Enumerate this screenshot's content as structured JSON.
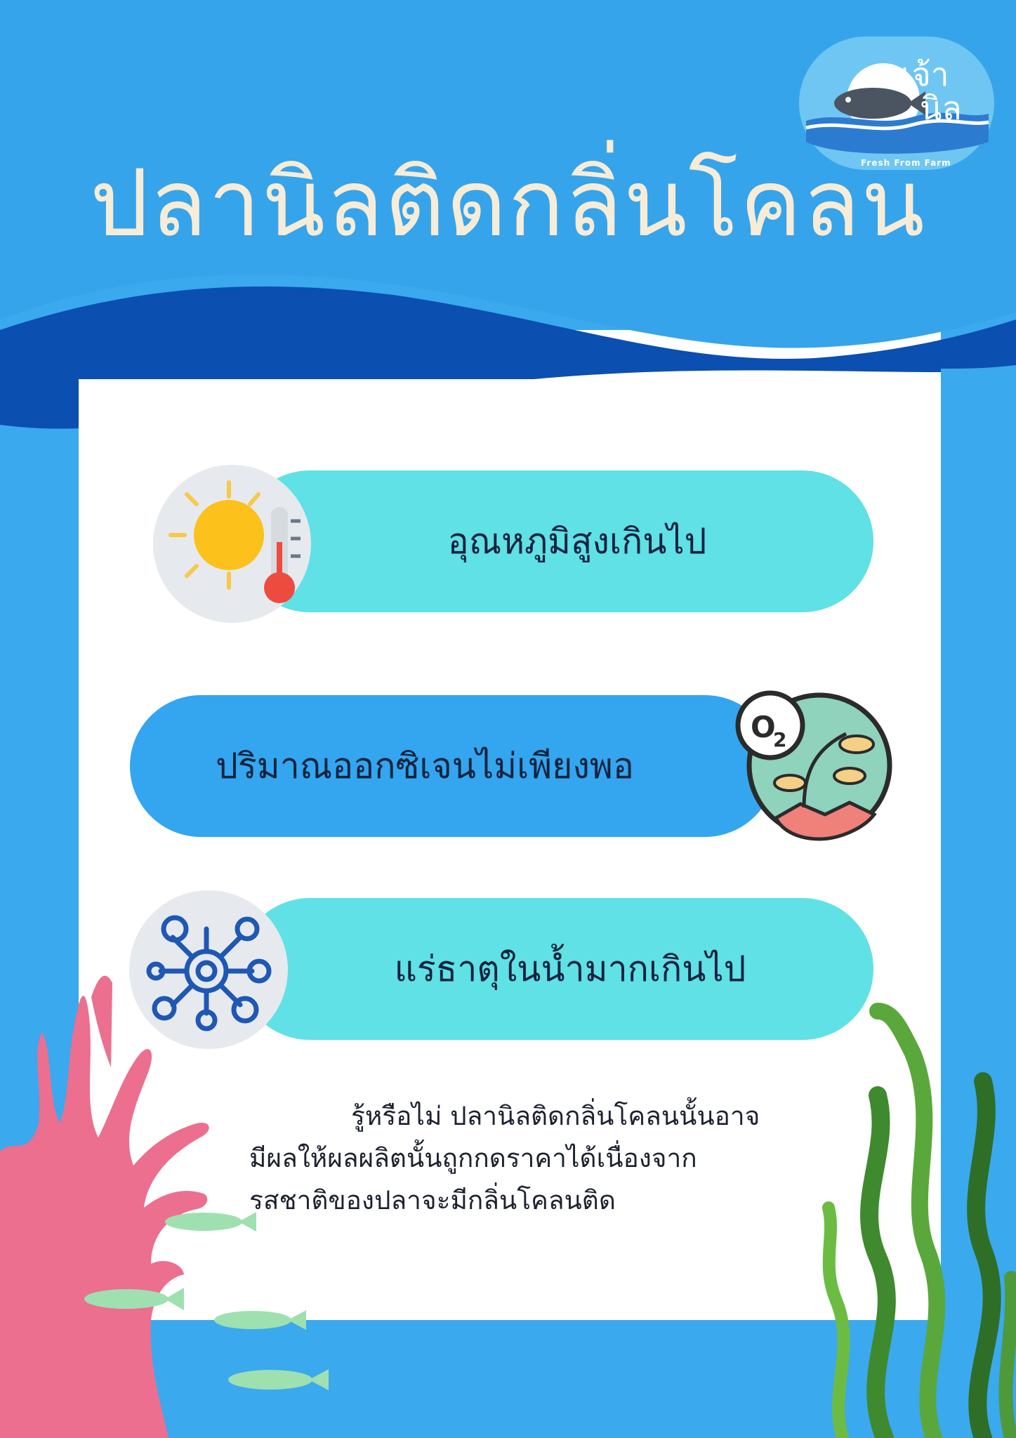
{
  "title": "ปลานิลติดกลิ่นโคลน",
  "logo": {
    "name_line1": "เจ้า",
    "name_line2": "นิล",
    "tagline": "Fresh From Farm"
  },
  "causes": [
    {
      "label": "อุณหภูมิสูงเกินไป",
      "icon": "sun-thermometer-icon"
    },
    {
      "label": "ปริมาณออกซิเจนไม่เพียงพอ",
      "icon": "oxygen-plants-icon"
    },
    {
      "label": "แร่ธาตุในน้ำมากเกินไป",
      "icon": "mineral-molecule-icon"
    }
  ],
  "fact": {
    "line1": "รู้หรือไม่ ปลานิลติดกลิ่นโคลนนั้นอาจ",
    "line2": "มีผลให้ผลผลิตนั้นถูกกดราคาได้เนื่องจาก",
    "line3": "รสชาติของปลาจะมีกลิ่นโคลนติด"
  },
  "colors": {
    "background": "#3aa9ee",
    "wave_dark": "#0b4fb0",
    "title": "#f6ecd8",
    "pill_cyan": "#5fe1e6",
    "pill_blue": "#33a6ef",
    "coral": "#ec6f8f",
    "seaweed": "#4e9a3a"
  }
}
